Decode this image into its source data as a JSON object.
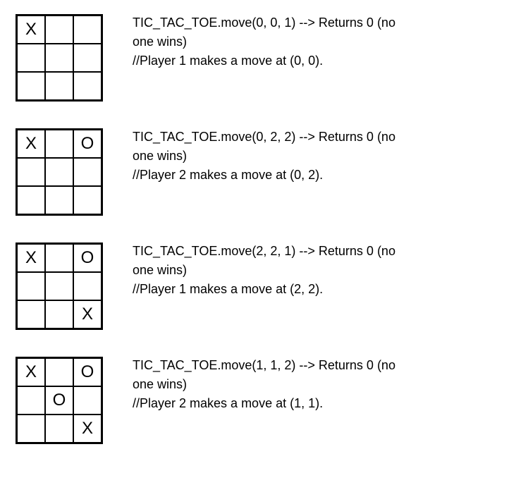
{
  "examples": [
    {
      "board": [
        [
          "X",
          "",
          ""
        ],
        [
          "",
          "",
          ""
        ],
        [
          "",
          "",
          ""
        ]
      ],
      "call_line": "TIC_TAC_TOE.move(0, 0, 1) --> Returns 0 (no",
      "result_line": "one wins)",
      "comment_line": "//Player 1 makes a move at (0, 0)."
    },
    {
      "board": [
        [
          "X",
          "",
          "O"
        ],
        [
          "",
          "",
          ""
        ],
        [
          "",
          "",
          ""
        ]
      ],
      "call_line": "TIC_TAC_TOE.move(0, 2, 2) --> Returns 0 (no",
      "result_line": "one wins)",
      "comment_line": "//Player 2 makes a move at (0, 2)."
    },
    {
      "board": [
        [
          "X",
          "",
          "O"
        ],
        [
          "",
          "",
          ""
        ],
        [
          "",
          "",
          "X"
        ]
      ],
      "call_line": "TIC_TAC_TOE.move(2, 2, 1) --> Returns 0 (no",
      "result_line": "one wins)",
      "comment_line": "//Player 1 makes a move at (2, 2)."
    },
    {
      "board": [
        [
          "X",
          "",
          "O"
        ],
        [
          "",
          "O",
          ""
        ],
        [
          "",
          "",
          "X"
        ]
      ],
      "call_line": "TIC_TAC_TOE.move(1, 1, 2) --> Returns 0 (no",
      "result_line": "one wins)",
      "comment_line": "//Player 2 makes a move at (1, 1)."
    }
  ]
}
